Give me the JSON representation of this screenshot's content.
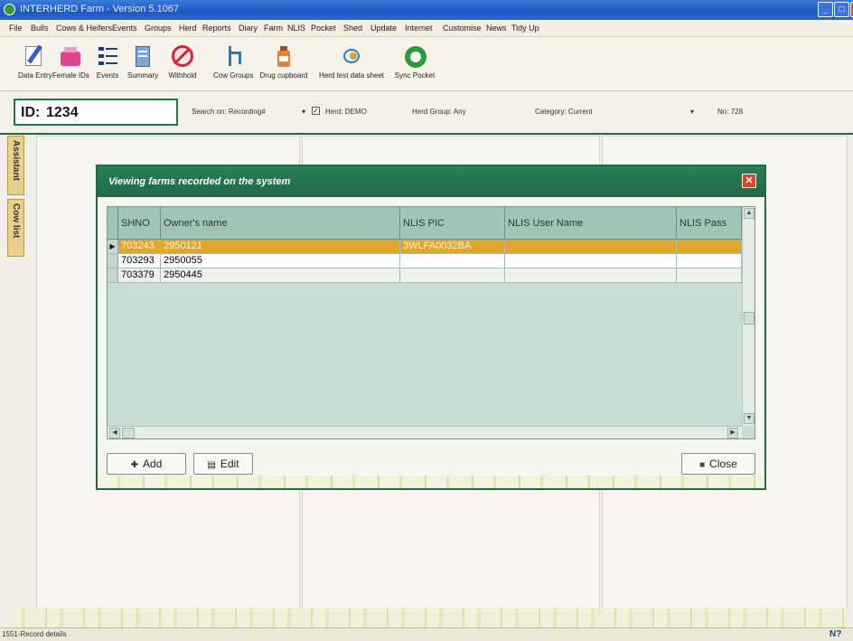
{
  "window": {
    "title": "INTERHERD Farm - Version 5.1067"
  },
  "menu": [
    "File",
    "Bulls",
    "Cows & Heifers",
    "Events",
    "Groups",
    "Herd",
    "Reports",
    "Diary",
    "Farm",
    "NLIS",
    "Pocket",
    "Shed",
    "Update",
    "Internet",
    "Customise",
    "News",
    "Tidy Up"
  ],
  "toolbar": [
    {
      "label": "Data Entry",
      "icon": "pencil-icon"
    },
    {
      "label": "Female IDs",
      "icon": "cow-id-icon"
    },
    {
      "label": "Events",
      "icon": "list-icon"
    },
    {
      "label": "Summary",
      "icon": "summary-icon"
    },
    {
      "label": "Withhold",
      "icon": "prohibit-icon"
    },
    {
      "label": "Cow Groups",
      "icon": "cow-groups-icon"
    },
    {
      "label": "Drug cupboard",
      "icon": "bottle-icon"
    },
    {
      "label": "Herd test data sheet",
      "icon": "herd-test-icon"
    },
    {
      "label": "Sync Pocket",
      "icon": "sync-icon"
    }
  ],
  "search": {
    "id_label": "ID:",
    "id_value": "1234",
    "search_on": "Search on: Recording#",
    "herd": "Herd: DEMO",
    "herd_group": "Herd Group: Any",
    "category": "Category: Current",
    "count": "No: 728"
  },
  "side_tabs": [
    "Assistant",
    "Cow list"
  ],
  "dialog": {
    "title": "Viewing farms recorded on the system",
    "columns": [
      "SHNO",
      "Owner's name",
      "NLIS PIC",
      "NLIS User Name",
      "NLIS Pass"
    ],
    "rows": [
      [
        "703243",
        "2950121",
        "3WLFA0032BA",
        "",
        ""
      ],
      [
        "703293",
        "2950055",
        "",
        "",
        ""
      ],
      [
        "703379",
        "2950445",
        "",
        "",
        ""
      ]
    ],
    "selected_row": 0,
    "buttons": {
      "add": "Add",
      "edit": "Edit",
      "close": "Close"
    }
  },
  "status": {
    "text": "1551-Record details"
  },
  "colors": {
    "accent": "#1f6b45",
    "selection": "#e3a62c",
    "title_blue": "#1c58c4"
  }
}
